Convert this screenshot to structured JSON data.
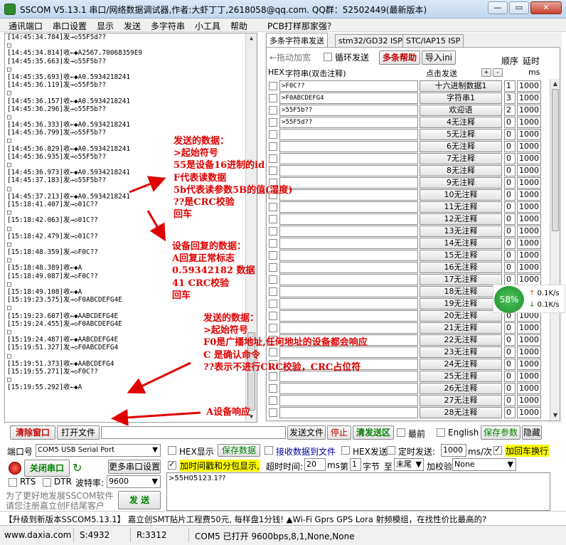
{
  "window": {
    "title": "SSCOM V5.13.1 串口/网络数据调试器,作者:大虾丁丁,2618058@qq.com. QQ群：52502449(最新版本)",
    "min": "—",
    "max": "▭",
    "close": "✕"
  },
  "menu": [
    "通讯端口",
    "串口设置",
    "显示",
    "发送",
    "多字符串",
    "小工具",
    "帮助",
    "PCB打样那家强？"
  ],
  "receive_lines": [
    "[14:45:34.784]发→◇55F5d??",
    "□",
    "[14:45:34.814]收←◆A2567.70068359E9",
    "[14:45:35.663]发→◇55F5b??",
    "□",
    "[14:45:35.693]收←◆A0.5934218241",
    "[14:45:36.119]发→◇55F5b??",
    "□",
    "[14:45:36.157]收←◆A0.5934218241",
    "[14:45:36.296]发→◇55F5b??",
    "□",
    "[14:45:36.333]收←◆A0.5934218241",
    "[14:45:36.799]发→◇55F5b??",
    "□",
    "[14:45:36.829]收←◆A0.5934218241",
    "[14:45:36.935]发→◇55F5b??",
    "□",
    "[14:45:36.973]收←◆A0.5934218241",
    "[14:45:37.183]发→◇55F5b??",
    "□",
    "[14:45:37.213]收←◆A0.5934218241",
    "[15:18:41.407]发→◇01C??",
    "□",
    "[15:18:42.063]发→◇01C??",
    "□",
    "[15:18:42.479]发→◇01C??",
    "□",
    "[15:18:48.359]发→◇F0C??",
    "□",
    "[15:18:48.389]收←◆A",
    "[15:18:49.087]发→◇F0C??",
    "□",
    "[15:18:49.108]收←◆A",
    "[15:19:23.575]发→◇F0ABCDEFG4E",
    "□",
    "[15:19:23.607]收←◆AABCDEFG4E",
    "[15:19:24.455]发→◇F0ABCDEFG4E",
    "□",
    "[15:19:24.487]收←◆AABCDEFG4E",
    "[15:19:51.327]发→◇F0ABCDEFG4",
    "□",
    "[15:19:51.373]收←◆AABCDEFG4",
    "[15:19:55.271]发→◇F0C??",
    "□",
    "[15:19:55.292]收←◆A"
  ],
  "annotations": {
    "a1": "发送的数据：\n>起始符号\n55是设备16进制的id\nF代表读数据\n5b代表读参数5B的值(湿度)\n??是CRC校验\n回车",
    "a2": "设备回复的数据：\nA回复正常标志\n0.59342182 数据\n41 CRC校验\n回车",
    "a3": "发送的数据：\n>起始符号\nF0是广播地址,任何地址的设备都会响应\nC 是确认命令\n??表示不进行CRC校验，CRC占位符",
    "a4": "A设备响应"
  },
  "tabs": [
    "多条字符串发送",
    "stm32/GD32 ISP",
    "STC/IAP15 ISP"
  ],
  "multi": {
    "drag_add": "←拖动加宽",
    "loop_send": "循环发送",
    "help": "多条帮助",
    "import": "导入ini",
    "order": "顺序",
    "delay": "延时",
    "hex": "HEX",
    "str_col": "字符串(双击注释)",
    "click_send": "点击发送",
    "plus": "+",
    "minus": "-",
    "ms": "ms",
    "rows": [
      {
        "cmd": ">F0C??",
        "label": "十六进制数据1",
        "order": "1",
        "delay": "1000"
      },
      {
        "cmd": ">F0ABCDEFG4",
        "label": "字符串1",
        "order": "3",
        "delay": "1000"
      },
      {
        "cmd": ">55F5b??",
        "label": "欢迎语",
        "order": "2",
        "delay": "1000"
      },
      {
        "cmd": ">55F5d??",
        "label": "4无注释",
        "order": "0",
        "delay": "1000"
      },
      {
        "cmd": "",
        "label": "5无注释",
        "order": "0",
        "delay": "1000"
      },
      {
        "cmd": "",
        "label": "6无注释",
        "order": "0",
        "delay": "1000"
      },
      {
        "cmd": "",
        "label": "7无注释",
        "order": "0",
        "delay": "1000"
      },
      {
        "cmd": "",
        "label": "8无注释",
        "order": "0",
        "delay": "1000"
      },
      {
        "cmd": "",
        "label": "9无注释",
        "order": "0",
        "delay": "1000"
      },
      {
        "cmd": "",
        "label": "10无注释",
        "order": "0",
        "delay": "1000"
      },
      {
        "cmd": "",
        "label": "11无注释",
        "order": "0",
        "delay": "1000"
      },
      {
        "cmd": "",
        "label": "12无注释",
        "order": "0",
        "delay": "1000"
      },
      {
        "cmd": "",
        "label": "13无注释",
        "order": "0",
        "delay": "1000"
      },
      {
        "cmd": "",
        "label": "14无注释",
        "order": "0",
        "delay": "1000"
      },
      {
        "cmd": "",
        "label": "15无注释",
        "order": "0",
        "delay": "1000"
      },
      {
        "cmd": "",
        "label": "16无注释",
        "order": "0",
        "delay": "1000"
      },
      {
        "cmd": "",
        "label": "17无注释",
        "order": "0",
        "delay": "1000"
      },
      {
        "cmd": "",
        "label": "18无注释",
        "order": "0",
        "delay": "1000"
      },
      {
        "cmd": "",
        "label": "19无注释",
        "order": "0",
        "delay": "1000"
      },
      {
        "cmd": "",
        "label": "20无注释",
        "order": "0",
        "delay": "1000"
      },
      {
        "cmd": "",
        "label": "21无注释",
        "order": "0",
        "delay": "1000"
      },
      {
        "cmd": "",
        "label": "22无注释",
        "order": "0",
        "delay": "1000"
      },
      {
        "cmd": "",
        "label": "23无注释",
        "order": "0",
        "delay": "1000"
      },
      {
        "cmd": "",
        "label": "24无注释",
        "order": "0",
        "delay": "1000"
      },
      {
        "cmd": "",
        "label": "25无注释",
        "order": "0",
        "delay": "1000"
      },
      {
        "cmd": "",
        "label": "26无注释",
        "order": "0",
        "delay": "1000"
      },
      {
        "cmd": "",
        "label": "27无注释",
        "order": "0",
        "delay": "1000"
      },
      {
        "cmd": "",
        "label": "28无注释",
        "order": "0",
        "delay": "1000"
      }
    ]
  },
  "speed": {
    "percent": "58%",
    "up": "0.1K/s",
    "down": "0.1K/s",
    "up_arrow": "↑",
    "down_arrow": "↓"
  },
  "toolbar": {
    "clear": "清除窗口",
    "open_file": "打开文件",
    "send_file": "发送文件",
    "stop": "停止",
    "clear_send": "清发送区",
    "topmost": "最前",
    "english": "English",
    "save_params": "保存参数",
    "hide": "隐藏"
  },
  "port": {
    "label": "端口号",
    "value": "COM5 USB Serial Port",
    "close": "关闭串口",
    "more": "更多串口设置",
    "rts": "RTS",
    "dtr": "DTR",
    "baud_label": "波特率:",
    "baud": "9600",
    "promo1": "为了更好地发展SSCOM软件",
    "promo2": "请您注册嘉立创F结尾客户",
    "send": "发 送"
  },
  "opts": {
    "hex_show": "HEX显示",
    "save_data": "保存数据",
    "recv_to_file": "接收数据到文件",
    "hex_send": "HEX发送",
    "timed_send": "定时发送:",
    "interval": "1000",
    "unit": "ms/次",
    "add_crlf": "加回车换行",
    "add_ts": "加时间戳和分包显示,",
    "timeout_label": "超时时间:",
    "timeout": "20",
    "ms": "ms",
    "nth": "第",
    "byte_no": "1",
    "byte_unit": "字节",
    "to": "至",
    "end": "末尾",
    "checksum": "加校验",
    "check_val": "None",
    "send_text": ">55H05123.1??"
  },
  "promo_line": "【升级到新版本SSCOM5.13.1】  嘉立创SMT贴片工程费50元, 每样盘1分钱! ▲Wi-Fi Gprs GPS Lora 射频模组，在找性价比最高的?",
  "status": {
    "url": "www.daxia.com",
    "s": "S:4932",
    "r": "R:3312",
    "state": "COM5 已打开  9600bps,8,1,None,None"
  }
}
